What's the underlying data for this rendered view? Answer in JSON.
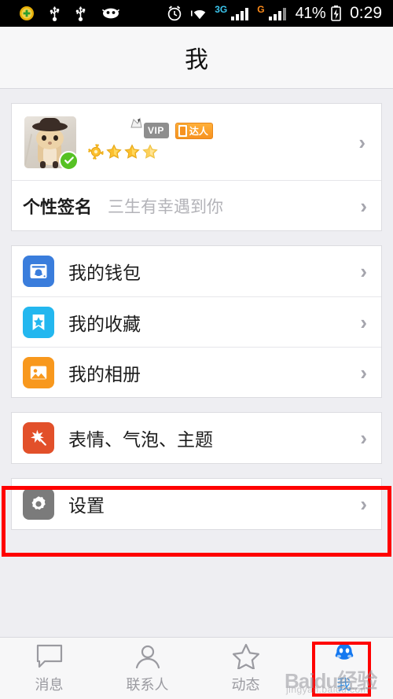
{
  "statusbar": {
    "icons_left": [
      "security-shield-icon",
      "usb-icon",
      "usb-icon",
      "android-debug-icon"
    ],
    "alarm_icon": "alarm-clock-icon",
    "wifi_icon": "wifi-icon",
    "sim1_label": "3G",
    "sim2_label": "G",
    "battery_percent": "41%",
    "battery_icon": "battery-charging-icon",
    "clock": "0:29"
  },
  "header": {
    "title": "我"
  },
  "profile": {
    "avatar_name": "cat-avatar",
    "verified_icon": "verified-check-icon",
    "vip_label": "VIP",
    "daren_label": "达人",
    "star_count": 4,
    "chevron": "›",
    "signature_label": "个性签名",
    "signature_value": "三生有幸遇到你"
  },
  "menu_groups": [
    {
      "items": [
        {
          "label": "我的钱包",
          "icon": "wallet-icon",
          "icon_class": "ic-wallet",
          "name": "row-my-wallet"
        },
        {
          "label": "我的收藏",
          "icon": "bookmark-star-icon",
          "icon_class": "ic-fav",
          "name": "row-my-favorites"
        },
        {
          "label": "我的相册",
          "icon": "photo-album-icon",
          "icon_class": "ic-album",
          "name": "row-my-album"
        }
      ]
    },
    {
      "items": [
        {
          "label": "表情、气泡、主题",
          "icon": "sparkle-wand-icon",
          "icon_class": "ic-theme",
          "name": "row-emoji-bubble-theme"
        }
      ]
    },
    {
      "items": [
        {
          "label": "设置",
          "icon": "gear-icon",
          "icon_class": "ic-setting",
          "name": "row-settings"
        }
      ]
    }
  ],
  "chevron": "›",
  "tabbar": {
    "tabs": [
      {
        "label": "消息",
        "icon": "chat-bubble-icon",
        "active": false
      },
      {
        "label": "联系人",
        "icon": "person-icon",
        "active": false
      },
      {
        "label": "动态",
        "icon": "star-outline-icon",
        "active": false
      },
      {
        "label": "我",
        "icon": "qq-penguin-icon",
        "active": true
      }
    ]
  },
  "highlights": {
    "settings_box_color": "#ff0000",
    "tab_box_color": "#ff0000"
  },
  "watermark": {
    "line1": "Baidu经验",
    "line2": "jingyan.baidu.com"
  }
}
